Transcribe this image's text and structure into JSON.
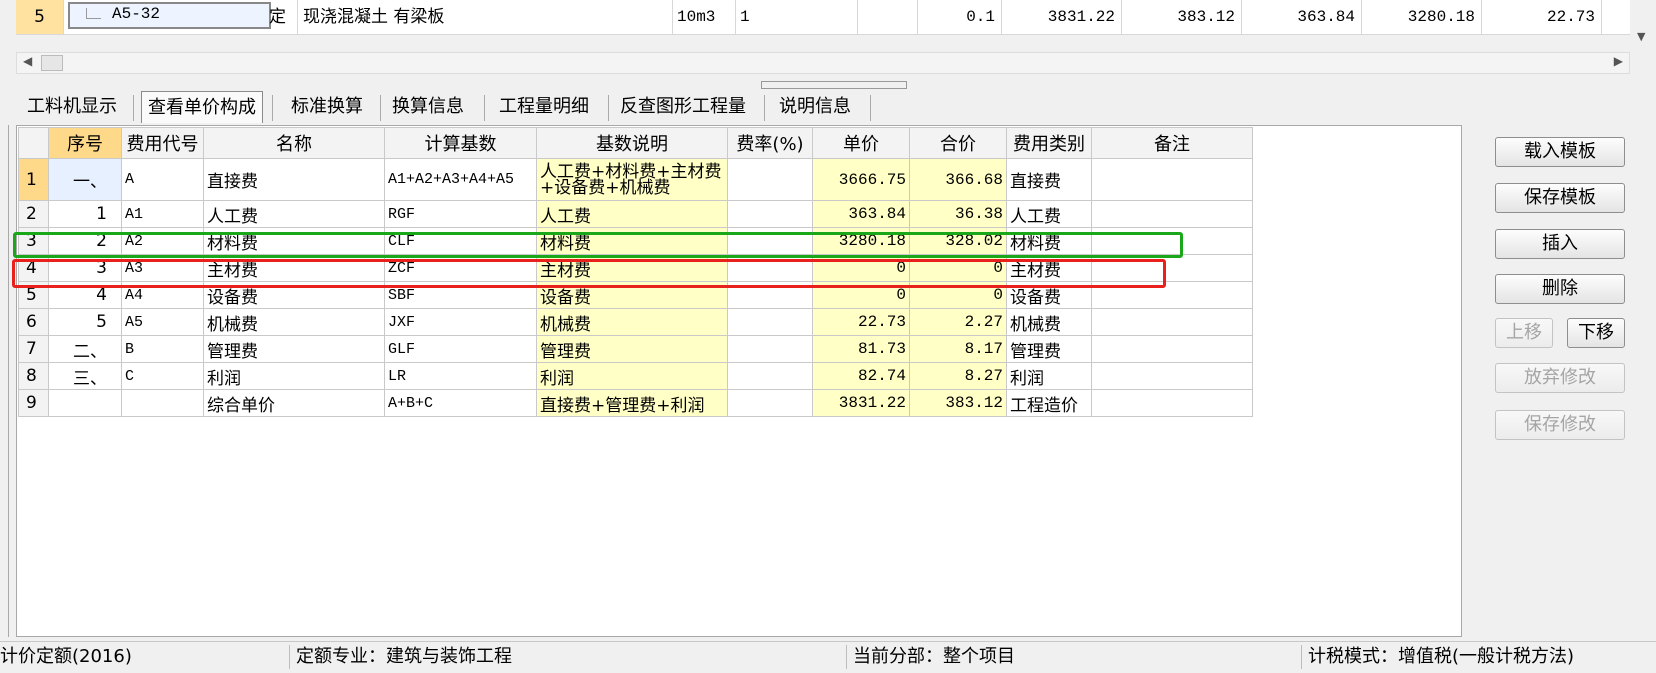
{
  "top_row": {
    "row_num": "5",
    "code": "A5-32",
    "type": "定",
    "name": "现浇混凝土 有梁板",
    "unit": "10m3",
    "quantity": "1",
    "rate": "0.1",
    "price1": "3831.22",
    "price2": "383.12",
    "price3": "363.84",
    "price4": "3280.18",
    "price5": "22.73"
  },
  "tabs": [
    {
      "label": "工料机显示"
    },
    {
      "label": "查看单价构成",
      "active": true
    },
    {
      "label": "标准换算"
    },
    {
      "label": "换算信息"
    },
    {
      "label": "工程量明细"
    },
    {
      "label": "反查图形工程量"
    },
    {
      "label": "说明信息"
    }
  ],
  "table": {
    "headers": [
      "",
      "序号",
      "费用代号",
      "名称",
      "计算基数",
      "基数说明",
      "费率(%)",
      "单价",
      "合价",
      "费用类别",
      "备注"
    ],
    "rows": [
      {
        "rn": "1",
        "seq": "一、",
        "code": "A",
        "name": "直接费",
        "base": "A1+A2+A3+A4+A5",
        "desc": "人工费+材料费+主材费+设备费+机械费",
        "rate": "",
        "unit_price": "3666.75",
        "total": "366.68",
        "category": "直接费",
        "note": ""
      },
      {
        "rn": "2",
        "seq": "1",
        "code": "A1",
        "name": "人工费",
        "base": "RGF",
        "desc": "人工费",
        "rate": "",
        "unit_price": "363.84",
        "total": "36.38",
        "category": "人工费",
        "note": ""
      },
      {
        "rn": "3",
        "seq": "2",
        "code": "A2",
        "name": "材料费",
        "base": "CLF",
        "desc": "材料费",
        "rate": "",
        "unit_price": "3280.18",
        "total": "328.02",
        "category": "材料费",
        "note": ""
      },
      {
        "rn": "4",
        "seq": "3",
        "code": "A3",
        "name": "主材费",
        "base": "ZCF",
        "desc": "主材费",
        "rate": "",
        "unit_price": "0",
        "total": "0",
        "category": "主材费",
        "note": ""
      },
      {
        "rn": "5",
        "seq": "4",
        "code": "A4",
        "name": "设备费",
        "base": "SBF",
        "desc": "设备费",
        "rate": "",
        "unit_price": "0",
        "total": "0",
        "category": "设备费",
        "note": ""
      },
      {
        "rn": "6",
        "seq": "5",
        "code": "A5",
        "name": "机械费",
        "base": "JXF",
        "desc": "机械费",
        "rate": "",
        "unit_price": "22.73",
        "total": "2.27",
        "category": "机械费",
        "note": ""
      },
      {
        "rn": "7",
        "seq": "二、",
        "code": "B",
        "name": "管理费",
        "base": "GLF",
        "desc": "管理费",
        "rate": "",
        "unit_price": "81.73",
        "total": "8.17",
        "category": "管理费",
        "note": ""
      },
      {
        "rn": "8",
        "seq": "三、",
        "code": "C",
        "name": "利润",
        "base": "LR",
        "desc": "利润",
        "rate": "",
        "unit_price": "82.74",
        "total": "8.27",
        "category": "利润",
        "note": ""
      },
      {
        "rn": "9",
        "seq": "",
        "code": "",
        "name": "综合单价",
        "base": "A+B+C",
        "desc": "直接费+管理费+利润",
        "rate": "",
        "unit_price": "3831.22",
        "total": "383.12",
        "category": "工程造价",
        "note": ""
      }
    ]
  },
  "buttons": {
    "load_template": "载入模板",
    "save_template": "保存模板",
    "insert": "插入",
    "delete": "删除",
    "move_up": "上移",
    "move_down": "下移",
    "discard": "放弃修改",
    "save_changes": "保存修改"
  },
  "status": {
    "quota": "计价定额(2016)",
    "specialty": "定额专业：建筑与装饰工程",
    "section": "当前分部：整个项目",
    "tax_mode": "计税模式：增值税(一般计税方法)"
  },
  "colors": {
    "highlight_green": "#1aa81a",
    "highlight_red": "#e8211d",
    "yellow_cell": "#ffffc6",
    "header_orange": "#ffd98a"
  }
}
